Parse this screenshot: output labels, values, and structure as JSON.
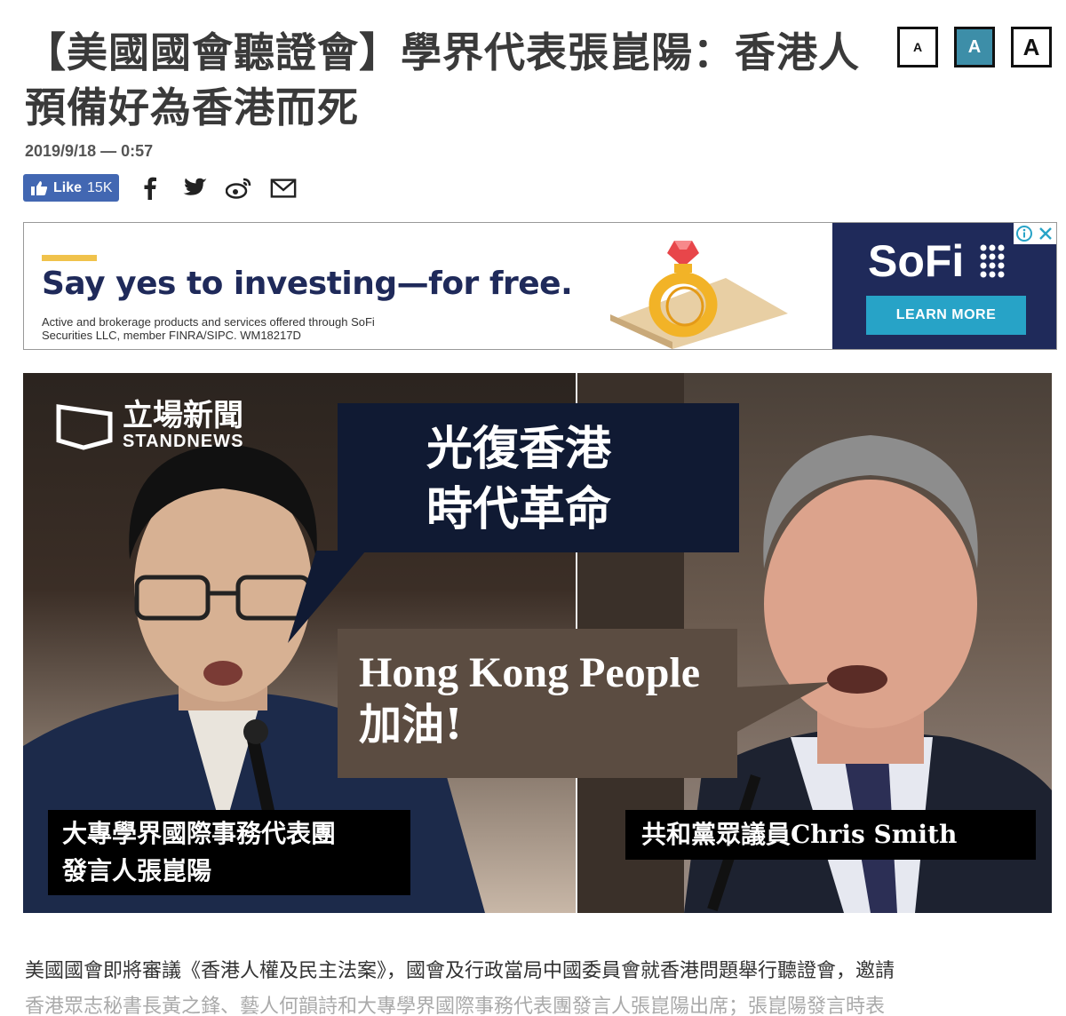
{
  "article": {
    "title": "【美國國會聽證會】學界代表張崑陽：香港人預備好為香港而死",
    "date": "2019/9/18 — 0:57"
  },
  "font_size_controls": {
    "small": "A",
    "medium": "A",
    "large": "A"
  },
  "share": {
    "like_label": "Like",
    "like_count": "15K",
    "icons": [
      "facebook-icon",
      "twitter-icon",
      "weibo-icon",
      "email-icon"
    ]
  },
  "ad": {
    "headline": "Say yes to investing—for free.",
    "fine_print": "Active and brokerage products and services offered through SoFi Securities LLC, member FINRA/SIPC. WM18217D",
    "brand": "SoFi",
    "cta": "LEARN MORE",
    "brand_color": "#1f2a5a",
    "cta_color": "#27a3c7"
  },
  "photo": {
    "brand_zh": "立場新聞",
    "brand_en": "STANDNEWS",
    "bubble1_line1": "光復香港",
    "bubble1_line2": "時代革命",
    "bubble2_en": "Hong Kong People",
    "bubble2_zh": "加油!",
    "caption_left_line1": "大專學界國際事務代表團",
    "caption_left_line2": "發言人張崑陽",
    "caption_right": "共和黨眾議員Chris Smith"
  },
  "body": {
    "paragraph_line1": "美國國會即將審議《香港人權及民主法案》，國會及行政當局中國委員會就香港問題舉行聽證會，邀請",
    "paragraph_line2": "香港眾志秘書長黃之鋒、藝人何韻詩和大專學界國際事務代表團發言人張崑陽出席；張崑陽發言時表"
  },
  "colors": {
    "accent": "#3d8ea8",
    "facebook": "#4267b2"
  }
}
